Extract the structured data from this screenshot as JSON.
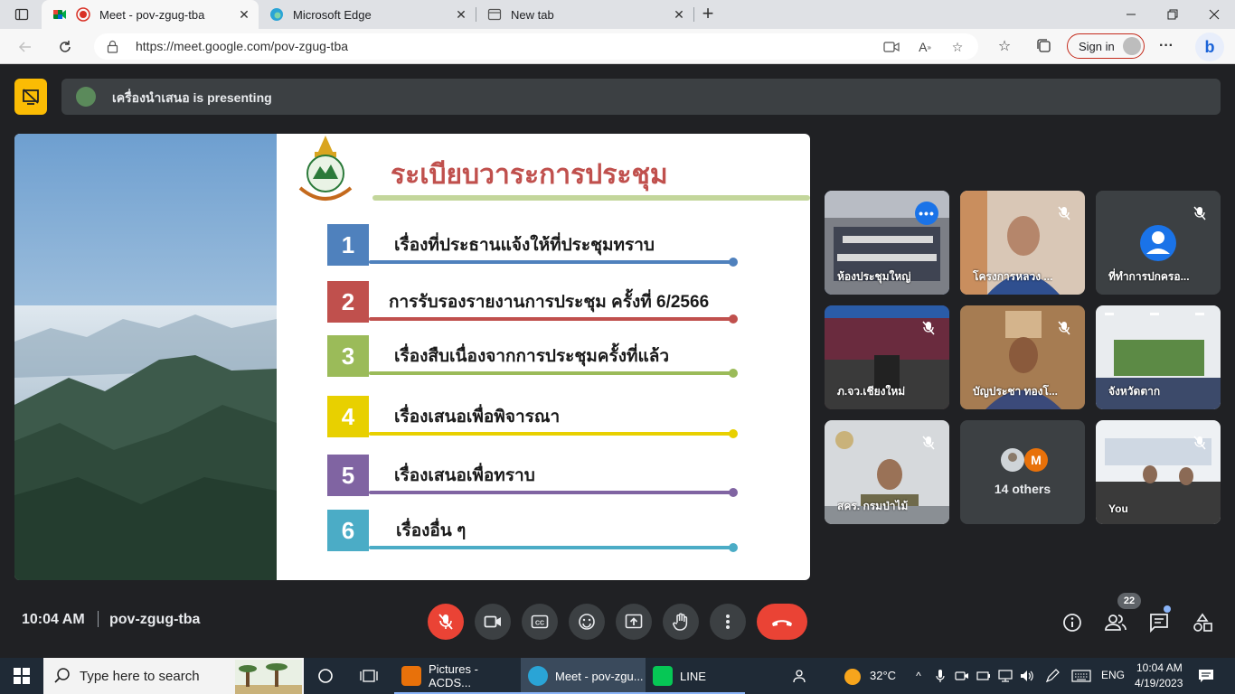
{
  "browser": {
    "tabs": [
      {
        "title": "Meet - pov-zgug-tba",
        "active": true
      },
      {
        "title": "Microsoft Edge",
        "active": false
      },
      {
        "title": "New tab",
        "active": false
      }
    ],
    "url": "https://meet.google.com/pov-zgug-tba",
    "signin_label": "Sign in"
  },
  "meet": {
    "presenting_text": "เครื่องนำเสนอ is presenting",
    "slide": {
      "title": "ระเบียบวาระการประชุม",
      "items": [
        {
          "num": "1",
          "label": "เรื่องที่ประธานแจ้งให้ที่ประชุมทราบ",
          "color": "#4f81bd"
        },
        {
          "num": "2",
          "label": "การรับรองรายงานการประชุม ครั้งที่ 6/2566",
          "color": "#c0504d"
        },
        {
          "num": "3",
          "label": "เรื่องสืบเนื่องจากการประชุมครั้งที่แล้ว",
          "color": "#9bbb59"
        },
        {
          "num": "4",
          "label": "เรื่องเสนอเพื่อพิจารณา",
          "color": "#e8d000"
        },
        {
          "num": "5",
          "label": "เรื่องเสนอเพื่อทราบ",
          "color": "#8064a2"
        },
        {
          "num": "6",
          "label": "เรื่องอื่น ๆ",
          "color": "#4bacc6"
        }
      ]
    },
    "participants": [
      {
        "name": "ห้องประชุมใหญ่"
      },
      {
        "name": "โครงการหลวง ..."
      },
      {
        "name": "ที่ทำการปกครอ..."
      },
      {
        "name": "ภ.จว.เชียงใหม่"
      },
      {
        "name": "บัญประชา ทองโ..."
      },
      {
        "name": "จังหวัดตาก"
      },
      {
        "name": "สคร. กรมป่าไม้"
      },
      {
        "name": "14 others",
        "avatar_letter": "M"
      },
      {
        "name": "You"
      }
    ],
    "clock": "10:04 AM",
    "meeting_code": "pov-zgug-tba",
    "people_count": "22"
  },
  "taskbar": {
    "search_placeholder": "Type here to search",
    "apps": [
      {
        "label": "Pictures - ACDS..."
      },
      {
        "label": "Meet - pov-zgu..."
      },
      {
        "label": "LINE"
      }
    ],
    "temperature": "32°C",
    "language": "ENG",
    "time": "10:04 AM",
    "date": "4/19/2023"
  },
  "colors": {
    "meet_bg": "#202124",
    "leave_red": "#ea4335",
    "accent_blue": "#1a73e8",
    "presenting_yellow": "#fbbc04"
  }
}
